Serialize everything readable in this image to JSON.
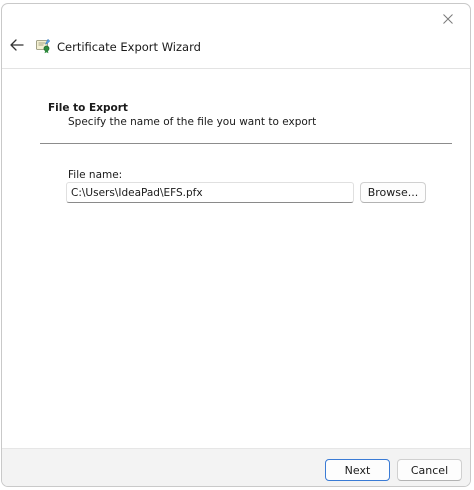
{
  "window": {
    "title": "Certificate Export Wizard",
    "close_icon": "close-icon",
    "back_icon": "back-arrow-icon",
    "app_icon": "certificate-icon"
  },
  "section": {
    "title": "File to Export",
    "description": "Specify the name of the file you want to export"
  },
  "file_name": {
    "label": "File name:",
    "value": "C:\\Users\\IdeaPad\\EFS.pfx"
  },
  "buttons": {
    "browse": "Browse...",
    "next": "Next",
    "cancel": "Cancel"
  },
  "colors": {
    "accent": "#3a7bd5",
    "footer_bg": "#f3f3f3"
  }
}
